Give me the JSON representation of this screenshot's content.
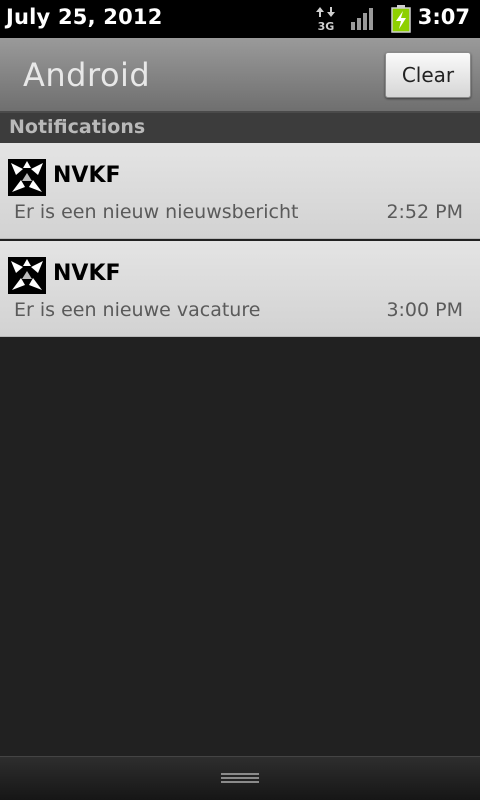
{
  "status_bar": {
    "date": "July 25, 2012",
    "time": "3:07",
    "network_type": "3G",
    "icons": [
      "data-arrows-3g-icon",
      "signal-strength-icon",
      "battery-charging-icon"
    ]
  },
  "header": {
    "title": "Android",
    "clear_label": "Clear"
  },
  "section": {
    "title": "Notifications"
  },
  "notifications": [
    {
      "app": "NVKF",
      "text": "Er is een nieuw nieuwsbericht",
      "time": "2:52 PM",
      "icon": "nvkf-app-icon"
    },
    {
      "app": "NVKF",
      "text": "Er is een nieuwe vacature",
      "time": "3:00 PM",
      "icon": "nvkf-app-icon"
    }
  ],
  "colors": {
    "status_bar_bg": "#000000",
    "header_bg": "#8a8a8a",
    "section_bg": "#3c3c3c",
    "notification_bg": "#dcdcdc",
    "screen_bg": "#212121",
    "battery_green": "#8ed000"
  }
}
